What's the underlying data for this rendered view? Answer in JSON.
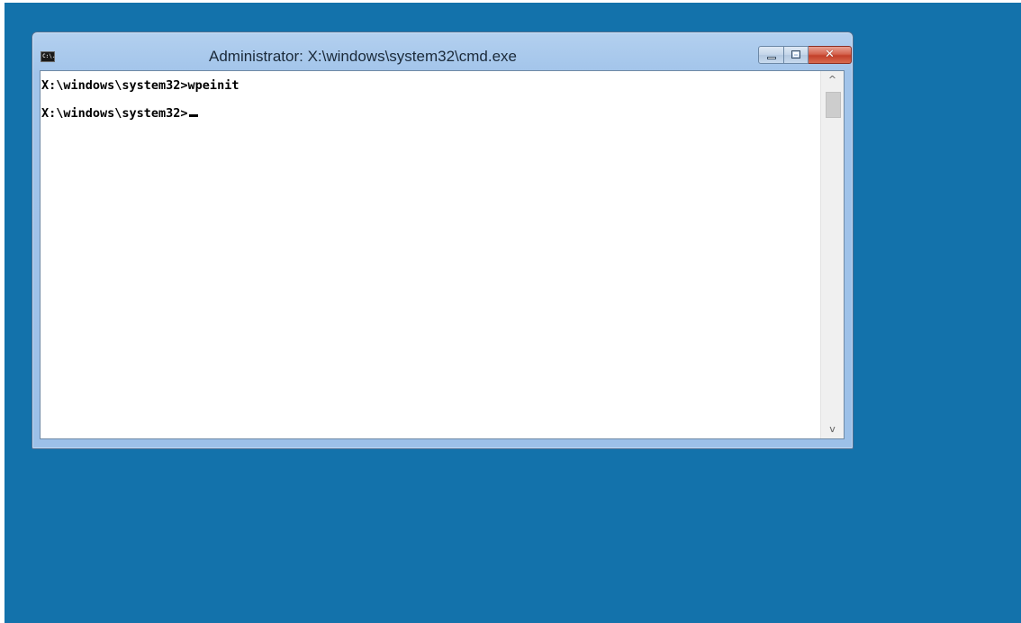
{
  "window": {
    "title": "Administrator: X:\\windows\\system32\\cmd.exe",
    "icon": "cmd-icon",
    "icon_text": "C:\\.",
    "caption_buttons": {
      "minimize_icon": "minimize-icon",
      "maximize_icon": "maximize-icon",
      "close_icon": "close-icon",
      "close_glyph": "✕"
    }
  },
  "console": {
    "lines": [
      "X:\\windows\\system32>wpeinit",
      "X:\\windows\\system32>"
    ]
  },
  "scrollbar": {
    "up_glyph": "^",
    "down_glyph": "v"
  },
  "colors": {
    "desktop": "#1372ab",
    "close_button": "#c3402a",
    "console_bg": "#ffffff",
    "console_text": "#000000"
  }
}
